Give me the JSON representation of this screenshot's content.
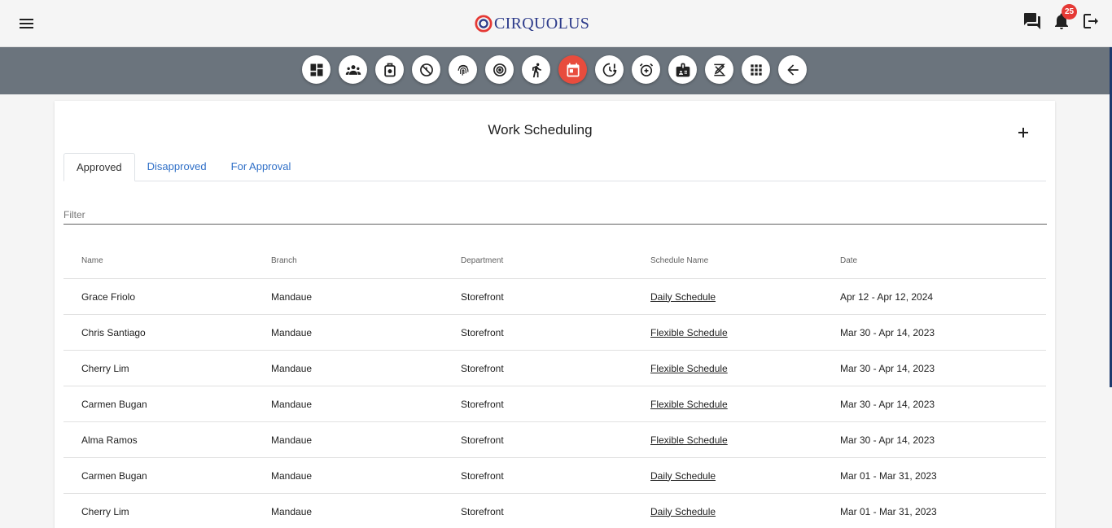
{
  "header": {
    "brand": "CIRQUOLUS",
    "notification_count": "25"
  },
  "icons": {
    "menu": "hamburger-menu-icon",
    "chat": "chat-icon",
    "bell": "bell-icon",
    "logout": "logout-icon"
  },
  "nav": [
    {
      "name": "dashboard-icon",
      "active": false
    },
    {
      "name": "team-icon",
      "active": false
    },
    {
      "name": "leave-icon",
      "active": false
    },
    {
      "name": "absence-icon",
      "active": false
    },
    {
      "name": "fingerprint-icon",
      "active": false
    },
    {
      "name": "target-icon",
      "active": false
    },
    {
      "name": "running-icon",
      "active": false
    },
    {
      "name": "calendar-icon",
      "active": true
    },
    {
      "name": "overtime-icon",
      "active": false
    },
    {
      "name": "alarm-add-icon",
      "active": false
    },
    {
      "name": "id-badge-icon",
      "active": false
    },
    {
      "name": "signature-icon",
      "active": false
    },
    {
      "name": "apps-grid-icon",
      "active": false
    },
    {
      "name": "back-arrow-icon",
      "active": false
    }
  ],
  "page": {
    "title": "Work Scheduling",
    "tabs": [
      "Approved",
      "Disapproved",
      "For Approval"
    ],
    "filter_placeholder": "Filter"
  },
  "table": {
    "columns": [
      "Name",
      "Branch",
      "Department",
      "Schedule Name",
      "Date"
    ],
    "rows": [
      {
        "name": "Grace Friolo",
        "branch": "Mandaue",
        "department": "Storefront",
        "schedule": "Daily Schedule",
        "date": "Apr 12 - Apr 12, 2024"
      },
      {
        "name": "Chris Santiago",
        "branch": "Mandaue",
        "department": "Storefront",
        "schedule": "Flexible Schedule",
        "date": "Mar 30 - Apr 14, 2023"
      },
      {
        "name": "Cherry Lim",
        "branch": "Mandaue",
        "department": "Storefront",
        "schedule": "Flexible Schedule",
        "date": "Mar 30 - Apr 14, 2023"
      },
      {
        "name": "Carmen Bugan",
        "branch": "Mandaue",
        "department": "Storefront",
        "schedule": "Flexible Schedule",
        "date": "Mar 30 - Apr 14, 2023"
      },
      {
        "name": "Alma Ramos",
        "branch": "Mandaue",
        "department": "Storefront",
        "schedule": "Flexible Schedule",
        "date": "Mar 30 - Apr 14, 2023"
      },
      {
        "name": "Carmen Bugan",
        "branch": "Mandaue",
        "department": "Storefront",
        "schedule": "Daily Schedule",
        "date": "Mar 01 - Mar 31, 2023"
      },
      {
        "name": "Cherry Lim",
        "branch": "Mandaue",
        "department": "Storefront",
        "schedule": "Daily Schedule",
        "date": "Mar 01 - Mar 31, 2023"
      }
    ]
  },
  "colors": {
    "accent": "#e84c3d",
    "iconbar": "#6b747d",
    "brand": "#2c3a8a",
    "tab_link": "#2f6fc7"
  }
}
